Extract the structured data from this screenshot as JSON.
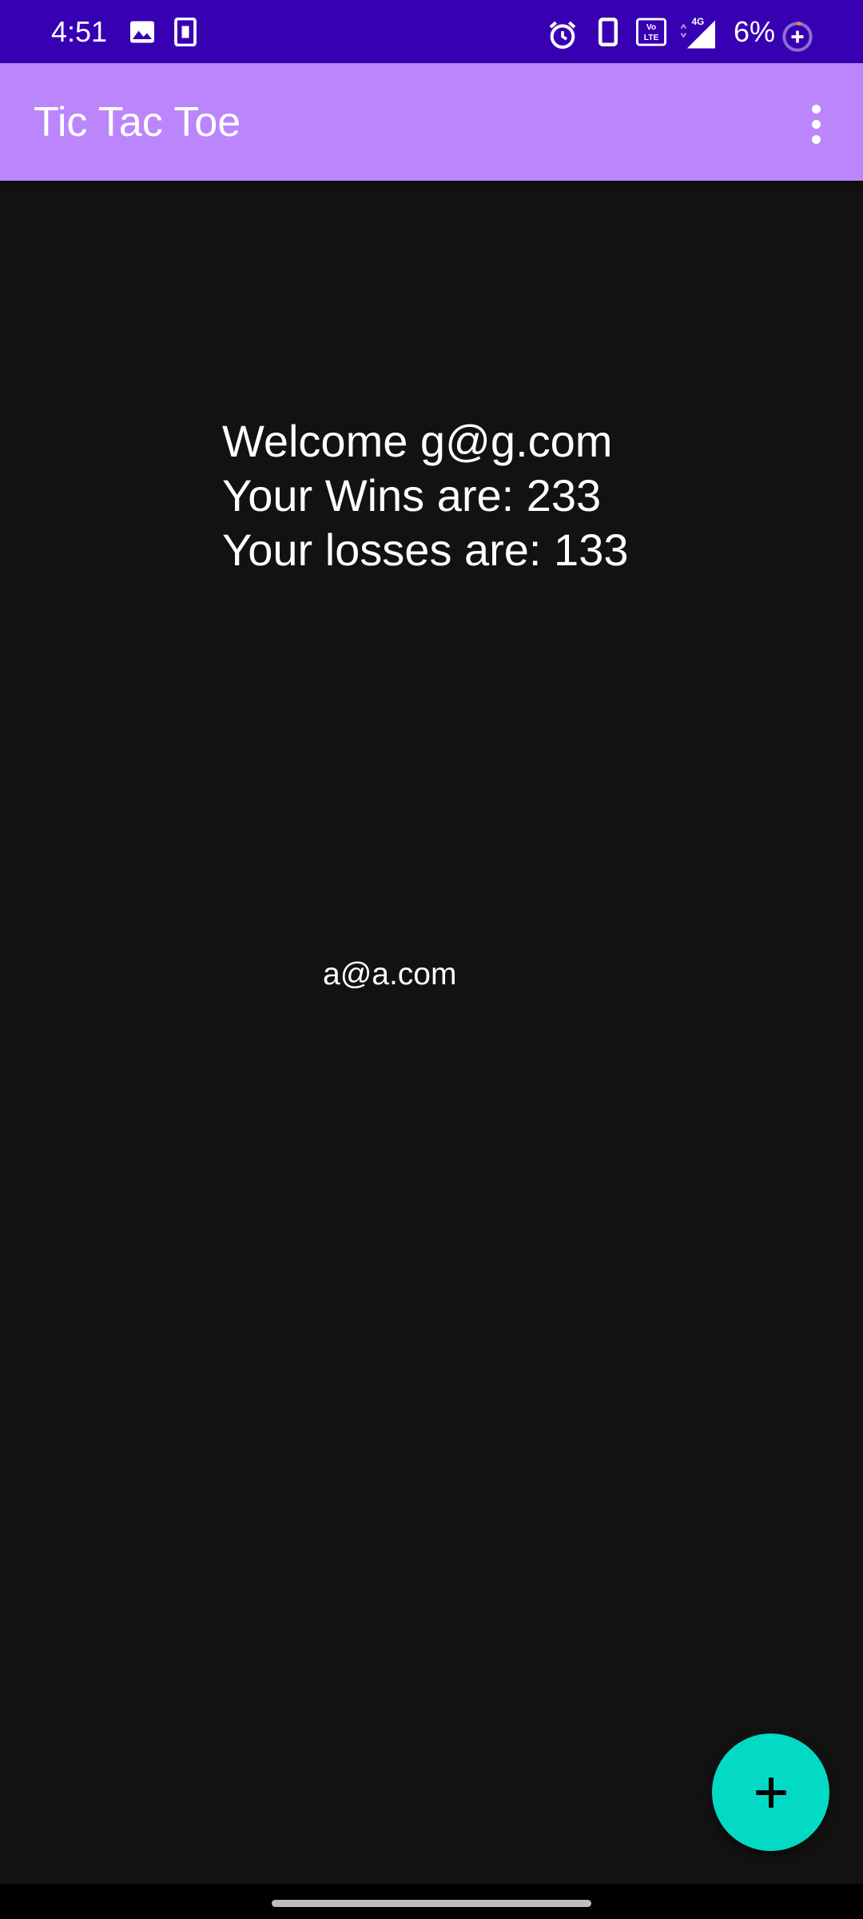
{
  "status_bar": {
    "time": "4:51",
    "battery_percent": "6%",
    "icons": [
      "image-icon",
      "sim-card-icon",
      "alarm-icon",
      "phone-icon",
      "volte-icon",
      "signal-4g-icon",
      "battery-saver-icon"
    ]
  },
  "app_bar": {
    "title": "Tic Tac Toe",
    "menu_icon": "more-vert-icon"
  },
  "welcome": {
    "line1": "Welcome g@g.com",
    "line2": "Your Wins are: 233",
    "line3": "Your losses are: 133"
  },
  "players": [
    {
      "email": "a@a.com"
    }
  ],
  "fab": {
    "icon": "plus-icon"
  },
  "colors": {
    "status_bar": "#3700b3",
    "app_bar": "#bb86fc",
    "background": "#121212",
    "fab": "#03dac5"
  }
}
